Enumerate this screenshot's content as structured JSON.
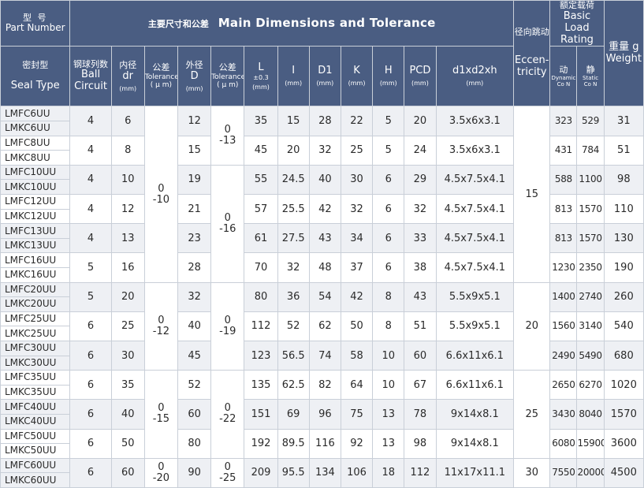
{
  "header": {
    "part_cn": "型 号",
    "part_en": "Part Number",
    "main_cn": "主要尺寸和公差",
    "main_en": "Main Dimensions and Tolerance",
    "ecc_cn": "径向跳动",
    "ecc_en": "Eccen-tricity",
    "load_cn": "额定载荷",
    "load_en": "Basic Load Rating",
    "weight_cn": "重量 g",
    "weight_en": "Weight",
    "seal_cn": "密封型",
    "seal_en": "Seal Type",
    "ball_cn": "钢球列数",
    "ball_en1": "Ball",
    "ball_en2": "Circuit",
    "dr_cn": "内径",
    "dr_en": "dr",
    "tol_cn": "公差",
    "tol_en": "Tolerance",
    "tol_unit": "( μ m)",
    "D_cn": "外径",
    "D_en": "D",
    "L_en": "L",
    "L_tol": "±0.3",
    "I_en": "I",
    "D1_en": "D1",
    "K_en": "K",
    "H_en": "H",
    "PCD_en": "PCD",
    "d123_en": "d1xd2xh",
    "mm": "(mm)",
    "dyn_cn": "动",
    "dyn_en1": "Dynamic",
    "dyn_en2": "Co N",
    "sta_cn": "静",
    "sta_en1": "Static",
    "sta_en2": "Co N"
  },
  "rows": [
    {
      "pn1": "LMFC6UU",
      "pn2": "LMKC6UU",
      "ball": "4",
      "dr": "6",
      "D": "12",
      "L": "35",
      "I": "15",
      "D1": "28",
      "K": "22",
      "H": "5",
      "PCD": "20",
      "d": "3.5x6x3.1",
      "dyn": "323",
      "sta": "529",
      "wt": "31"
    },
    {
      "pn1": "LMFC8UU",
      "pn2": "LMKC8UU",
      "ball": "4",
      "dr": "8",
      "D": "15",
      "L": "45",
      "I": "20",
      "D1": "32",
      "K": "25",
      "H": "5",
      "PCD": "24",
      "d": "3.5x6x3.1",
      "dyn": "431",
      "sta": "784",
      "wt": "51"
    },
    {
      "pn1": "LMFC10UU",
      "pn2": "LMKC10UU",
      "ball": "4",
      "dr": "10",
      "D": "19",
      "L": "55",
      "I": "24.5",
      "D1": "40",
      "K": "30",
      "H": "6",
      "PCD": "29",
      "d": "4.5x7.5x4.1",
      "dyn": "588",
      "sta": "1100",
      "wt": "98"
    },
    {
      "pn1": "LMFC12UU",
      "pn2": "LMKC12UU",
      "ball": "4",
      "dr": "12",
      "D": "21",
      "L": "57",
      "I": "25.5",
      "D1": "42",
      "K": "32",
      "H": "6",
      "PCD": "32",
      "d": "4.5x7.5x4.1",
      "dyn": "813",
      "sta": "1570",
      "wt": "110"
    },
    {
      "pn1": "LMFC13UU",
      "pn2": "LMKC13UU",
      "ball": "4",
      "dr": "13",
      "D": "23",
      "L": "61",
      "I": "27.5",
      "D1": "43",
      "K": "34",
      "H": "6",
      "PCD": "33",
      "d": "4.5x7.5x4.1",
      "dyn": "813",
      "sta": "1570",
      "wt": "130"
    },
    {
      "pn1": "LMFC16UU",
      "pn2": "LMKC16UU",
      "ball": "5",
      "dr": "16",
      "D": "28",
      "L": "70",
      "I": "32",
      "D1": "48",
      "K": "37",
      "H": "6",
      "PCD": "38",
      "d": "4.5x7.5x4.1",
      "dyn": "1230",
      "sta": "2350",
      "wt": "190"
    },
    {
      "pn1": "LMFC20UU",
      "pn2": "LMKC20UU",
      "ball": "5",
      "dr": "20",
      "D": "32",
      "L": "80",
      "I": "36",
      "D1": "54",
      "K": "42",
      "H": "8",
      "PCD": "43",
      "d": "5.5x9x5.1",
      "dyn": "1400",
      "sta": "2740",
      "wt": "260"
    },
    {
      "pn1": "LMFC25UU",
      "pn2": "LMKC25UU",
      "ball": "6",
      "dr": "25",
      "D": "40",
      "L": "112",
      "I": "52",
      "D1": "62",
      "K": "50",
      "H": "8",
      "PCD": "51",
      "d": "5.5x9x5.1",
      "dyn": "1560",
      "sta": "3140",
      "wt": "540"
    },
    {
      "pn1": "LMFC30UU",
      "pn2": "LMKC30UU",
      "ball": "6",
      "dr": "30",
      "D": "45",
      "L": "123",
      "I": "56.5",
      "D1": "74",
      "K": "58",
      "H": "10",
      "PCD": "60",
      "d": "6.6x11x6.1",
      "dyn": "2490",
      "sta": "5490",
      "wt": "680"
    },
    {
      "pn1": "LMFC35UU",
      "pn2": "LMKC35UU",
      "ball": "6",
      "dr": "35",
      "D": "52",
      "L": "135",
      "I": "62.5",
      "D1": "82",
      "K": "64",
      "H": "10",
      "PCD": "67",
      "d": "6.6x11x6.1",
      "dyn": "2650",
      "sta": "6270",
      "wt": "1020"
    },
    {
      "pn1": "LMFC40UU",
      "pn2": "LMKC40UU",
      "ball": "6",
      "dr": "40",
      "D": "60",
      "L": "151",
      "I": "69",
      "D1": "96",
      "K": "75",
      "H": "13",
      "PCD": "78",
      "d": "9x14x8.1",
      "dyn": "3430",
      "sta": "8040",
      "wt": "1570"
    },
    {
      "pn1": "LMFC50UU",
      "pn2": "LMKC50UU",
      "ball": "6",
      "dr": "50",
      "D": "80",
      "L": "192",
      "I": "89.5",
      "D1": "116",
      "K": "92",
      "H": "13",
      "PCD": "98",
      "d": "9x14x8.1",
      "dyn": "6080",
      "sta": "15900",
      "wt": "3600"
    },
    {
      "pn1": "LMFC60UU",
      "pn2": "LMKC60UU",
      "ball": "6",
      "dr": "60",
      "D": "90",
      "L": "209",
      "I": "95.5",
      "D1": "134",
      "K": "106",
      "H": "18",
      "PCD": "112",
      "d": "11x17x11.1",
      "dyn": "7550",
      "sta": "20000",
      "wt": "4500"
    }
  ],
  "dr_tol": [
    {
      "upper": "0",
      "lower": "-10"
    },
    {
      "upper": "0",
      "lower": "-12"
    },
    {
      "upper": "0",
      "lower": "-15"
    },
    {
      "upper": "0",
      "lower": "-20"
    }
  ],
  "D_tol": [
    {
      "upper": "0",
      "lower": "-13"
    },
    {
      "upper": "0",
      "lower": "-16"
    },
    {
      "upper": "0",
      "lower": "-19"
    },
    {
      "upper": "0",
      "lower": "-22"
    },
    {
      "upper": "0",
      "lower": "-25"
    }
  ],
  "ecc": [
    "15",
    "20",
    "25",
    "30"
  ],
  "colors": {
    "header_bg": "#4a5d82",
    "alt_row": "#eef0f4",
    "border": "#c9cfd8"
  }
}
